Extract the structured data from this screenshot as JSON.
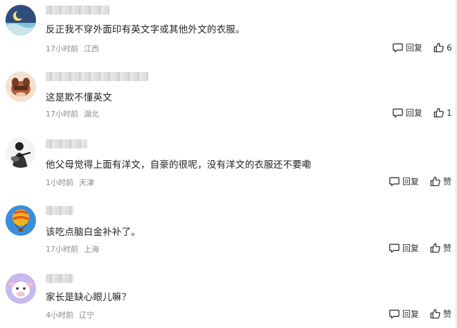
{
  "comments": [
    {
      "text": "反正我不穿外面印有英文字或其他外文的衣服。",
      "time": "17小时前",
      "location": "江西",
      "reply_label": "回复",
      "like_label": "6"
    },
    {
      "text": "这是欺不懂英文",
      "time": "17小时前",
      "location": "湖北",
      "reply_label": "回复",
      "like_label": "1"
    },
    {
      "text": "他父母觉得上面有洋文，自豪的很呢，没有洋文的衣服还不要嘞",
      "time": "1小时前",
      "location": "天津",
      "reply_label": "回复",
      "like_label": "赞"
    },
    {
      "text": "该吃点脑白金补补了。",
      "time": "17小时前",
      "location": "上海",
      "reply_label": "回复",
      "like_label": "赞"
    },
    {
      "text": "家长是缺心眼儿嘛？",
      "time": "4小时前",
      "location": "辽宁",
      "reply_label": "回复",
      "like_label": "赞"
    }
  ],
  "icons": {
    "reply": "comment-bubble-icon",
    "like": "thumbs-up-icon"
  },
  "colors": {
    "text": "#1f1f1f",
    "meta": "#8a8a8a",
    "background": "#ffffff"
  }
}
